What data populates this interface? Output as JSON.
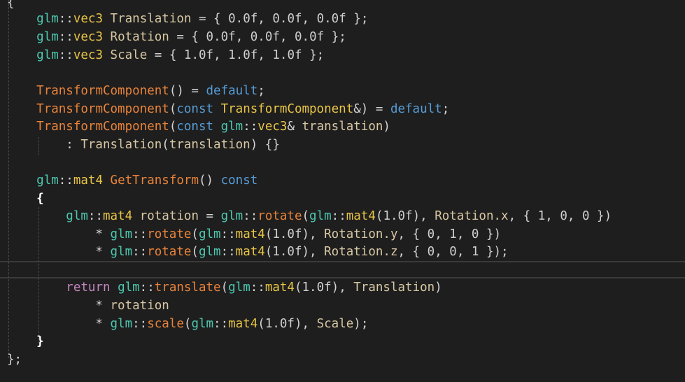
{
  "editor": {
    "lines": [
      [
        {
          "t": "{",
          "c": "punc"
        }
      ],
      [
        {
          "t": "    ",
          "c": "punc"
        },
        {
          "t": "glm",
          "c": "ns"
        },
        {
          "t": "::",
          "c": "punc"
        },
        {
          "t": "vec3",
          "c": "type"
        },
        {
          "t": " ",
          "c": "punc"
        },
        {
          "t": "Translation",
          "c": "var"
        },
        {
          "t": " = { ",
          "c": "punc"
        },
        {
          "t": "0.0f",
          "c": "num"
        },
        {
          "t": ", ",
          "c": "punc"
        },
        {
          "t": "0.0f",
          "c": "num"
        },
        {
          "t": ", ",
          "c": "punc"
        },
        {
          "t": "0.0f",
          "c": "num"
        },
        {
          "t": " };",
          "c": "punc"
        }
      ],
      [
        {
          "t": "    ",
          "c": "punc"
        },
        {
          "t": "glm",
          "c": "ns"
        },
        {
          "t": "::",
          "c": "punc"
        },
        {
          "t": "vec3",
          "c": "type"
        },
        {
          "t": " ",
          "c": "punc"
        },
        {
          "t": "Rotation",
          "c": "var"
        },
        {
          "t": " = { ",
          "c": "punc"
        },
        {
          "t": "0.0f",
          "c": "num"
        },
        {
          "t": ", ",
          "c": "punc"
        },
        {
          "t": "0.0f",
          "c": "num"
        },
        {
          "t": ", ",
          "c": "punc"
        },
        {
          "t": "0.0f",
          "c": "num"
        },
        {
          "t": " };",
          "c": "punc"
        }
      ],
      [
        {
          "t": "    ",
          "c": "punc"
        },
        {
          "t": "glm",
          "c": "ns"
        },
        {
          "t": "::",
          "c": "punc"
        },
        {
          "t": "vec3",
          "c": "type"
        },
        {
          "t": " ",
          "c": "punc"
        },
        {
          "t": "Scale",
          "c": "var"
        },
        {
          "t": " = { ",
          "c": "punc"
        },
        {
          "t": "1.0f",
          "c": "num"
        },
        {
          "t": ", ",
          "c": "punc"
        },
        {
          "t": "1.0f",
          "c": "num"
        },
        {
          "t": ", ",
          "c": "punc"
        },
        {
          "t": "1.0f",
          "c": "num"
        },
        {
          "t": " };",
          "c": "punc"
        }
      ],
      [],
      [
        {
          "t": "    ",
          "c": "punc"
        },
        {
          "t": "TransformComponent",
          "c": "fn"
        },
        {
          "t": "() = ",
          "c": "punc"
        },
        {
          "t": "default",
          "c": "kw"
        },
        {
          "t": ";",
          "c": "punc"
        }
      ],
      [
        {
          "t": "    ",
          "c": "punc"
        },
        {
          "t": "TransformComponent",
          "c": "fn"
        },
        {
          "t": "(",
          "c": "punc"
        },
        {
          "t": "const",
          "c": "kw"
        },
        {
          "t": " ",
          "c": "punc"
        },
        {
          "t": "TransformComponent",
          "c": "type"
        },
        {
          "t": "&) = ",
          "c": "punc"
        },
        {
          "t": "default",
          "c": "kw"
        },
        {
          "t": ";",
          "c": "punc"
        }
      ],
      [
        {
          "t": "    ",
          "c": "punc"
        },
        {
          "t": "TransformComponent",
          "c": "fn"
        },
        {
          "t": "(",
          "c": "punc"
        },
        {
          "t": "const",
          "c": "kw"
        },
        {
          "t": " ",
          "c": "punc"
        },
        {
          "t": "glm",
          "c": "ns"
        },
        {
          "t": "::",
          "c": "punc"
        },
        {
          "t": "vec3",
          "c": "type"
        },
        {
          "t": "& ",
          "c": "punc"
        },
        {
          "t": "translation",
          "c": "var"
        },
        {
          "t": ")",
          "c": "punc"
        }
      ],
      [
        {
          "t": "        : ",
          "c": "punc"
        },
        {
          "t": "Translation",
          "c": "var"
        },
        {
          "t": "(",
          "c": "punc"
        },
        {
          "t": "translation",
          "c": "var"
        },
        {
          "t": ") {}",
          "c": "punc"
        }
      ],
      [],
      [
        {
          "t": "    ",
          "c": "punc"
        },
        {
          "t": "glm",
          "c": "ns"
        },
        {
          "t": "::",
          "c": "punc"
        },
        {
          "t": "mat4",
          "c": "type"
        },
        {
          "t": " ",
          "c": "punc"
        },
        {
          "t": "GetTransform",
          "c": "fn"
        },
        {
          "t": "() ",
          "c": "punc"
        },
        {
          "t": "const",
          "c": "kw"
        }
      ],
      [
        {
          "t": "    ",
          "c": "punc"
        },
        {
          "t": "{",
          "c": "wbrace"
        }
      ],
      [
        {
          "t": "        ",
          "c": "punc"
        },
        {
          "t": "glm",
          "c": "ns"
        },
        {
          "t": "::",
          "c": "punc"
        },
        {
          "t": "mat4",
          "c": "type"
        },
        {
          "t": " ",
          "c": "punc"
        },
        {
          "t": "rotation",
          "c": "var"
        },
        {
          "t": " = ",
          "c": "punc"
        },
        {
          "t": "glm",
          "c": "ns"
        },
        {
          "t": "::",
          "c": "punc"
        },
        {
          "t": "rotate",
          "c": "fn"
        },
        {
          "t": "(",
          "c": "punc"
        },
        {
          "t": "glm",
          "c": "ns"
        },
        {
          "t": "::",
          "c": "punc"
        },
        {
          "t": "mat4",
          "c": "type"
        },
        {
          "t": "(",
          "c": "punc"
        },
        {
          "t": "1.0f",
          "c": "num"
        },
        {
          "t": "), ",
          "c": "punc"
        },
        {
          "t": "Rotation.x",
          "c": "var"
        },
        {
          "t": ", { ",
          "c": "punc"
        },
        {
          "t": "1",
          "c": "num"
        },
        {
          "t": ", ",
          "c": "punc"
        },
        {
          "t": "0",
          "c": "num"
        },
        {
          "t": ", ",
          "c": "punc"
        },
        {
          "t": "0",
          "c": "num"
        },
        {
          "t": " })",
          "c": "punc"
        }
      ],
      [
        {
          "t": "            * ",
          "c": "punc"
        },
        {
          "t": "glm",
          "c": "ns"
        },
        {
          "t": "::",
          "c": "punc"
        },
        {
          "t": "rotate",
          "c": "fn"
        },
        {
          "t": "(",
          "c": "punc"
        },
        {
          "t": "glm",
          "c": "ns"
        },
        {
          "t": "::",
          "c": "punc"
        },
        {
          "t": "mat4",
          "c": "type"
        },
        {
          "t": "(",
          "c": "punc"
        },
        {
          "t": "1.0f",
          "c": "num"
        },
        {
          "t": "), ",
          "c": "punc"
        },
        {
          "t": "Rotation.y",
          "c": "var"
        },
        {
          "t": ", { ",
          "c": "punc"
        },
        {
          "t": "0",
          "c": "num"
        },
        {
          "t": ", ",
          "c": "punc"
        },
        {
          "t": "1",
          "c": "num"
        },
        {
          "t": ", ",
          "c": "punc"
        },
        {
          "t": "0",
          "c": "num"
        },
        {
          "t": " })",
          "c": "punc"
        }
      ],
      [
        {
          "t": "            * ",
          "c": "punc"
        },
        {
          "t": "glm",
          "c": "ns"
        },
        {
          "t": "::",
          "c": "punc"
        },
        {
          "t": "rotate",
          "c": "fn"
        },
        {
          "t": "(",
          "c": "punc"
        },
        {
          "t": "glm",
          "c": "ns"
        },
        {
          "t": "::",
          "c": "punc"
        },
        {
          "t": "mat4",
          "c": "type"
        },
        {
          "t": "(",
          "c": "punc"
        },
        {
          "t": "1.0f",
          "c": "num"
        },
        {
          "t": "), ",
          "c": "punc"
        },
        {
          "t": "Rotation.z",
          "c": "var"
        },
        {
          "t": ", { ",
          "c": "punc"
        },
        {
          "t": "0",
          "c": "num"
        },
        {
          "t": ", ",
          "c": "punc"
        },
        {
          "t": "0",
          "c": "num"
        },
        {
          "t": ", ",
          "c": "punc"
        },
        {
          "t": "1",
          "c": "num"
        },
        {
          "t": " });",
          "c": "punc"
        }
      ],
      [],
      [
        {
          "t": "        ",
          "c": "punc"
        },
        {
          "t": "return",
          "c": "ctl"
        },
        {
          "t": " ",
          "c": "punc"
        },
        {
          "t": "glm",
          "c": "ns"
        },
        {
          "t": "::",
          "c": "punc"
        },
        {
          "t": "translate",
          "c": "fn"
        },
        {
          "t": "(",
          "c": "punc"
        },
        {
          "t": "glm",
          "c": "ns"
        },
        {
          "t": "::",
          "c": "punc"
        },
        {
          "t": "mat4",
          "c": "type"
        },
        {
          "t": "(",
          "c": "punc"
        },
        {
          "t": "1.0f",
          "c": "num"
        },
        {
          "t": "), ",
          "c": "punc"
        },
        {
          "t": "Translation",
          "c": "var"
        },
        {
          "t": ")",
          "c": "punc"
        }
      ],
      [
        {
          "t": "            * ",
          "c": "punc"
        },
        {
          "t": "rotation",
          "c": "var"
        }
      ],
      [
        {
          "t": "            * ",
          "c": "punc"
        },
        {
          "t": "glm",
          "c": "ns"
        },
        {
          "t": "::",
          "c": "punc"
        },
        {
          "t": "scale",
          "c": "fn"
        },
        {
          "t": "(",
          "c": "punc"
        },
        {
          "t": "glm",
          "c": "ns"
        },
        {
          "t": "::",
          "c": "punc"
        },
        {
          "t": "mat4",
          "c": "type"
        },
        {
          "t": "(",
          "c": "punc"
        },
        {
          "t": "1.0f",
          "c": "num"
        },
        {
          "t": "), ",
          "c": "punc"
        },
        {
          "t": "Scale",
          "c": "var"
        },
        {
          "t": ");",
          "c": "punc"
        }
      ],
      [
        {
          "t": "    ",
          "c": "punc"
        },
        {
          "t": "}",
          "c": "wbrace"
        }
      ],
      [
        {
          "t": "};",
          "c": "punc"
        }
      ]
    ]
  },
  "colors": {
    "background": "#1e1e1e",
    "namespace": "#4ec9b0",
    "type": "#e8c547",
    "function": "#e8833a",
    "variable": "#d8c7a4",
    "keyword": "#569cd6",
    "control": "#c586c0",
    "number": "#cfcfcf",
    "punctuation": "#d4d4d4"
  }
}
